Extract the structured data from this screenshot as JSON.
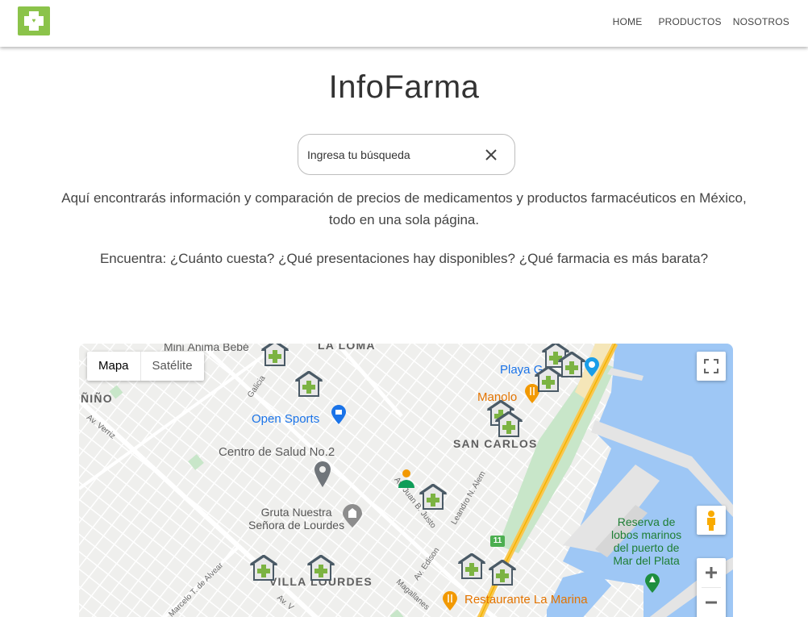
{
  "nav": {
    "links": [
      "HOME",
      "PRODUCTOS",
      "NOSOTROS"
    ]
  },
  "hero": {
    "title": "InfoFarma",
    "search_placeholder": "Ingresa tu búsqueda",
    "description_line1": "Aquí encontrarás información y comparación de precios de medicamentos y productos farmacéuticos en México,",
    "description_line2": "todo en una sola página.",
    "tagline": "Encuentra: ¿Cuánto cuesta? ¿Qué presentaciones hay disponibles? ¿Qué farmacia es más barata?"
  },
  "map": {
    "type_buttons": [
      "Mapa",
      "Satélite"
    ],
    "active_type": "Mapa",
    "labels": {
      "mini_anima": "Mini Ánima Bebé",
      "la_loma": "LA LOMA",
      "playa": "Playa G",
      "nino": "ÑIÑO",
      "galicia": "Galicia",
      "manolo": "Manolo",
      "av_verriz": "Av. Verriz",
      "open_sports": "Open Sports",
      "san_carlos": "SAN CARLOS",
      "centro_salud": "Centro de Salud No.2",
      "juan_b_justo": "Av. Juan B. Justo",
      "leandro_alem": "Leandro N. Alem",
      "gruta_1": "Gruta Nuestra",
      "gruta_2": "Señora de Lourdes",
      "reserva_1": "Reserva de",
      "reserva_2": "lobos marinos",
      "reserva_3": "del puerto de",
      "reserva_4": "Mar del Plata",
      "villa_lourdes": "VILLA LOURDES",
      "av_edison": "Av. Edison",
      "marcelo_alvear": "Marcelo T. de Alvear",
      "av_v": "Av. V",
      "magallanes": "Magallanes",
      "restaurante": "Restaurante La Marina",
      "route_11": "11"
    },
    "colors": {
      "land": "#f2f2f0",
      "water": "#9ec7f5",
      "park": "#c8e6c9",
      "highway": "#f9c74f",
      "pharmacy_cross": "#7cb342"
    }
  }
}
